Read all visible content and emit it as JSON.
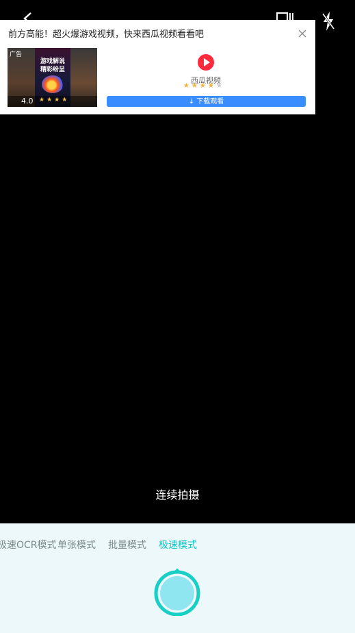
{
  "ad": {
    "title": "前方高能！超火爆游戏视频，快来西瓜视频看看吧",
    "tag": "广告",
    "game_title": "游戏解说精彩纷呈",
    "rating": "4.0",
    "rating_stars": "★★★★",
    "app_name": "西瓜视频",
    "app_stars_on": "★★★★",
    "app_stars_off": "★",
    "download_label": "下载观看"
  },
  "camera": {
    "hint": "连续拍摄"
  },
  "modes": [
    {
      "label": "极速OCR模式"
    },
    {
      "label": "单张模式"
    },
    {
      "label": "批量模式"
    },
    {
      "label": "极速模式"
    }
  ],
  "active_mode_index": 3,
  "colors": {
    "accent": "#11c4c9",
    "download": "#3a8dff",
    "panel": "#edf8fa"
  },
  "icons": [
    "back-icon",
    "gallery-icon",
    "flash-off-icon",
    "close-icon",
    "download-icon",
    "play-icon"
  ]
}
